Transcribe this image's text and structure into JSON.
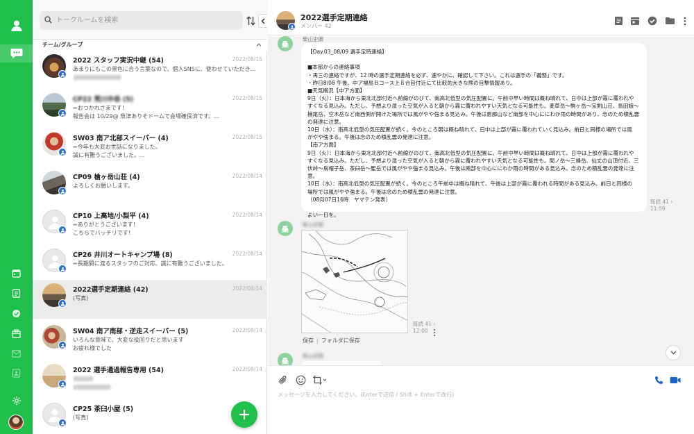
{
  "search": {
    "placeholder": "トークルームを検索"
  },
  "section": {
    "label": "チーム/グループ"
  },
  "rooms": [
    {
      "name": "2022 スタッフ実況中継 (54)",
      "date": "2022/08/15",
      "line1": "あまりにもこの景色に合う言葉なので、個人SNSに、使わせていただきます",
      "line2": ""
    },
    {
      "name": "CP22 荒川中岳 (5)",
      "date": "2022/08/15",
      "line1": "おつかれさまです！",
      "line2": "報告会は 10/29@ 魚津ありそドームで会場確保済です。..."
    },
    {
      "name": "SW03 南ア北部スイーパー (4)",
      "date": "2022/08/15",
      "line1": "今年も大変お世話になりました。",
      "line2": "誠に有難うございました。..."
    },
    {
      "name": "CP09 槍ヶ岳山荘 (4)",
      "date": "2022/08/14",
      "line1": "よろしくお願いします。",
      "line2": ""
    },
    {
      "name": "CP10 上高地/小梨平 (4)",
      "date": "2022/08/14",
      "line1": "ありがとうございます！",
      "line2": "こちらでバッチリです！"
    },
    {
      "name": "CP26 井川オートキャンプ場 (8)",
      "date": "2022/08/14",
      "line1": "長期間に渡るスタッフのご対応、誠に有難うございました。",
      "line2": ""
    },
    {
      "name": "2022選手定期連絡 (42)",
      "date": "2022/08/14",
      "line1": "(写真)",
      "line2": ""
    },
    {
      "name": "SW04 南ア南部・逆走スイーパー (5)",
      "date": "2022/08/14",
      "line1": "いろんな意味で、大変な役回りだと思います",
      "line2": "お疲れ様でした"
    },
    {
      "name": "2022 選手通過報告専用 (54)",
      "date": "2022/08/14",
      "line1": "",
      "line2": ""
    },
    {
      "name": "CP25 茶臼小屋 (5)",
      "date": "",
      "line1": "(写真)",
      "line2": ""
    }
  ],
  "chat": {
    "title": "2022選手定期連絡",
    "members": "メンバー 42",
    "sender_initial": "桑",
    "sender_name": "柴山史朗",
    "message_lines": [
      "【Day.03_08/09 選手定時連絡】",
      "",
      "■本部からの連絡事項",
      "・再三の連絡ですが、12 時の選手定期連絡を必ず、速やかに、確認して下さい。これは選手の「義務」です。",
      "・昨日8/08 午後、中ア福島Ｂコース上８合目付近にて比較的大きな熊の目撃情報あり。",
      "■天気概況【中ア方面】",
      "9日（火）：日本海から東北北部付近へ前線がのびて、南高北低型の気圧配置に。午前中早い時間は概ね晴れて、日中は上部が霧に覆われや",
      "すくなる見込み。ただし、予想より湿った空気が入ると朝から霧に覆われやすい天気となる可能性も。麦草岳〜駒ヶ岳〜宝剣山荘、島田娘〜",
      "檜尾岳、空木岳など南西側が開けた場所では風がやや強まる見込み。午後は恵那山など南部を中心ににわか雨の時間があり、念のため積乱雲",
      "の発達に注意。",
      "10日（水）：南高北低型の気圧配置が続く。今のところ朝は概ね晴れて、日中は上部が霧に覆われていく見込み。前日と同様の場所では風",
      "がやや強まる。午後は念のため積乱雲の発達に注意。",
      "【南ア方面】",
      "9日（火）：日本海から東北北部付近へ前線がのびて、南高北低型の気圧配置に。午前中早い時間は概ね晴れて、日中は上部が霧に覆われや",
      "すくなる見込み。ただし、予想より湿った空気が入ると朝から霧に覆われやすい天気となる可能性も。間ノ岳〜三峰岳、仙丈の山頂付近、三",
      "伏峠〜烏帽子岳、茶臼岳〜聖岳では風がやや強まる見込み。午後は南部を中心ににわか雨の時間がある見込み。念のため積乱雲の発達に注",
      "意。",
      "10日（水）：南高北低型の気圧配置が続く。今のところ午前中は概ね晴れて、午後は上部が霧に覆われる時間がある見込み。前日と同様の",
      "場所では風がやや強まる。午後は念のため積乱雲の発達に注意。",
      "（08月07日16時　ヤマテン発表）",
      "",
      "よい一日を。"
    ],
    "msg1_read": "既読 41",
    "msg1_time": "11:59",
    "img_read": "既読 41",
    "img_time": "12:00",
    "img_save": "保存",
    "img_save_folder": "フォルダに保存",
    "separator": "|"
  },
  "composer": {
    "placeholder": "メッセージを入力してください。(Enterで送信 / Shift + Enterで改行)"
  },
  "colors": {
    "brand": "#1fc04a",
    "badge": "#2a6ed0",
    "call": "#1e64c8"
  }
}
